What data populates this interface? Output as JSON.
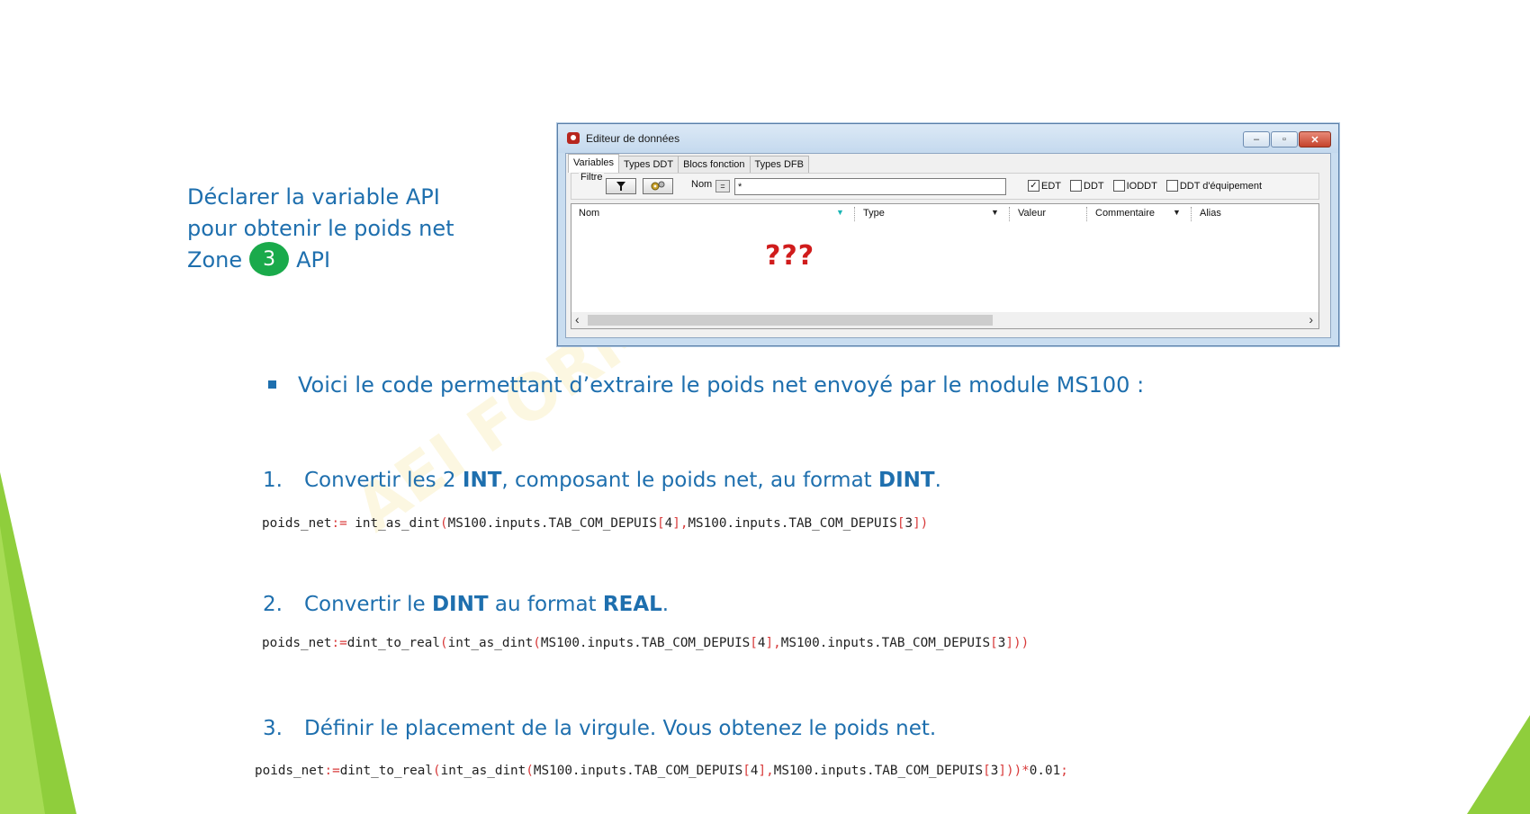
{
  "intro": {
    "line1": "Déclarer la variable API",
    "line2": "pour obtenir le poids net",
    "zone_label": "Zone",
    "zone_number": "3",
    "zone_suffix": "API"
  },
  "window": {
    "title": "Editeur de données",
    "minimize": "–",
    "maximize": "▫",
    "close": "✕",
    "tabs": [
      {
        "label": "Variables",
        "active": true
      },
      {
        "label": "Types DDT",
        "active": false
      },
      {
        "label": "Blocs fonction",
        "active": false
      },
      {
        "label": "Types DFB",
        "active": false
      }
    ],
    "filter": {
      "label": "Filtre",
      "nom_label": "Nom",
      "eq_label": "=",
      "name_value": "*",
      "checkboxes": [
        {
          "label": "EDT",
          "checked": true
        },
        {
          "label": "DDT",
          "checked": false
        },
        {
          "label": "IODDT",
          "checked": false
        },
        {
          "label": "DDT d'équipement",
          "checked": false
        }
      ]
    },
    "columns": [
      "Nom",
      "Type",
      "Valeur",
      "Commentaire",
      "Alias"
    ],
    "placeholder": "???"
  },
  "body": {
    "bullet": "Voici le code permettant d’extraire le poids net envoyé par le module MS100 :",
    "steps": [
      {
        "num": "1.",
        "pre": "Convertir les 2 ",
        "bold1": "INT",
        "mid": ", composant le poids net, au format ",
        "bold2": "DINT",
        "post": "."
      },
      {
        "num": "2.",
        "pre": "Convertir le ",
        "bold1": "DINT",
        "mid": " au format ",
        "bold2": "REAL",
        "post": "."
      },
      {
        "num": "3.",
        "text": "Définir le placement de la virgule. Vous obtenez le poids net."
      }
    ],
    "code1": {
      "a": "poids_net",
      "b": ":=",
      "c": " int_as_dint",
      "d": "(",
      "e": "MS100.inputs.TAB_COM_DEPUIS",
      "f": "[",
      "g": "4",
      "h": "],",
      "i": "MS100.inputs.TAB_COM_DEPUIS",
      "j": "[",
      "k": "3",
      "l": "])"
    },
    "code2": {
      "a": "poids_net",
      "b": ":=",
      "c": "dint_to_real",
      "d": "(",
      "e": "int_as_dint",
      "f": "(",
      "g": "MS100.inputs.TAB_COM_DEPUIS",
      "h": "[",
      "i": "4",
      "j": "],",
      "k": "MS100.inputs.TAB_COM_DEPUIS",
      "l": "[",
      "m": "3",
      "n": "]))"
    },
    "code3": {
      "a": "poids_net",
      "b": ":=",
      "c": "dint_to_real",
      "d": "(",
      "e": "int_as_dint",
      "f": "(",
      "g": "MS100.inputs.TAB_COM_DEPUIS",
      "h": "[",
      "i": "4",
      "j": "],",
      "k": "MS100.inputs.TAB_COM_DEPUIS",
      "l": "[",
      "m": "3",
      "n": "]))*",
      "o": "0.01",
      "p": ";"
    }
  },
  "watermark": "AEI FORMATION",
  "colors": {
    "text_blue": "#1e6fae",
    "badge_green": "#1aaa4b",
    "code_red": "#d83a3a",
    "deco_green": "#8fce3c"
  }
}
